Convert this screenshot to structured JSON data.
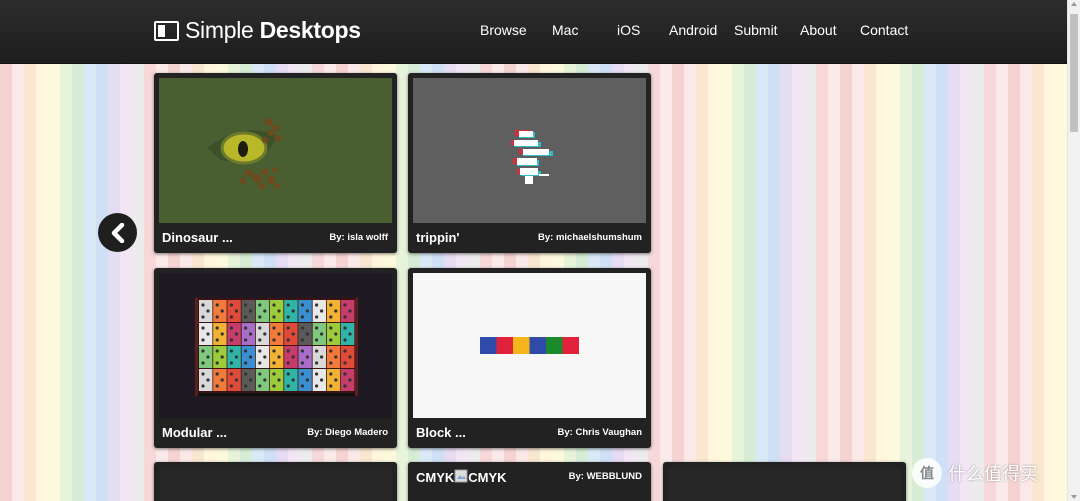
{
  "site": {
    "logo_light": "Simple ",
    "logo_bold": "Desktops"
  },
  "nav": {
    "items": [
      "Browse",
      "Mac",
      "iOS",
      "Android",
      "Submit",
      "About",
      "Contact"
    ]
  },
  "gallery": {
    "cards": [
      {
        "title": "Dinosaur ...",
        "author": "By: isla wolff",
        "thumb": "dinosaur-eye"
      },
      {
        "title": "trippin'",
        "author": "By: michaelshumshum",
        "thumb": "glitch-figure"
      },
      {
        "title": "Modular ...",
        "author": "By: Diego Madero",
        "thumb": "modular-synth"
      },
      {
        "title": "Block ...",
        "author": "By: Chris Vaughan",
        "thumb": "color-blocks"
      },
      {
        "title": "",
        "author": "",
        "thumb": "dark"
      },
      {
        "title": "CMYK",
        "title_alt": "CMYK",
        "author": "By: WEBBLUND",
        "thumb": "broken-image"
      },
      {
        "title": "",
        "author": "",
        "thumb": "dark"
      }
    ]
  },
  "watermark": {
    "badge": "值",
    "text": "什么值得买"
  },
  "colors": {
    "header_bg": "#262626",
    "card_bg": "#222222",
    "dino_bg": "#4a5f31",
    "glitch_bg": "#5f5f5f",
    "synth_bg": "#1f1a22",
    "block_bg": "#f7f7f7",
    "blocks": [
      "#2f4aa8",
      "#e0223b",
      "#f6b51a",
      "#2f4aa8",
      "#1a8a2c",
      "#e0223b"
    ]
  }
}
